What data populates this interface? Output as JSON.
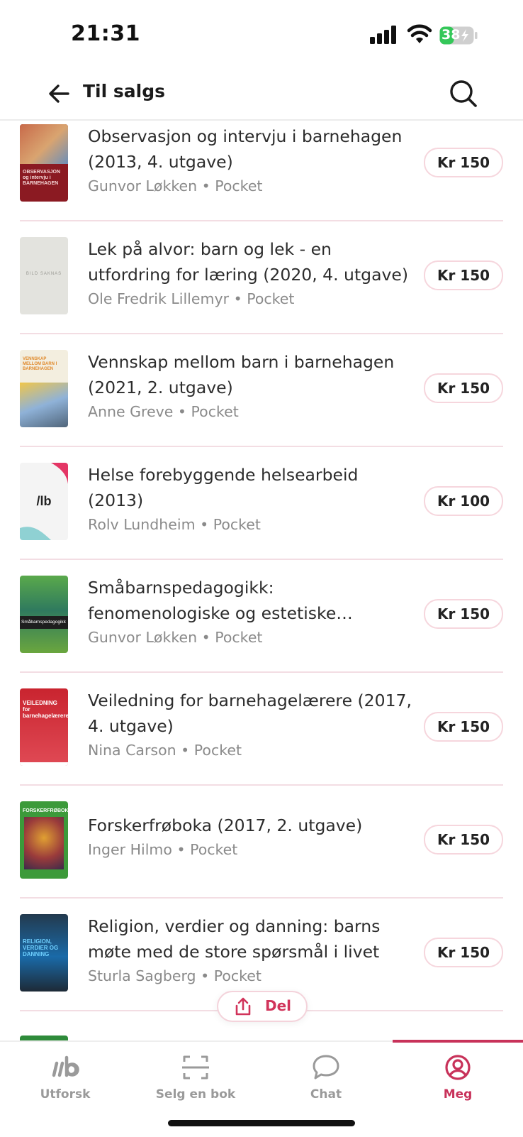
{
  "status_bar": {
    "time": "21:31",
    "battery": "38"
  },
  "header": {
    "title": "Til salgs"
  },
  "books": [
    {
      "title": "Observasjon og intervju i barnehagen (2013, 4. utgave)",
      "author": "Gunvor Løkken",
      "separator": "•",
      "format": "Pocket",
      "price": "Kr 150",
      "cover": {
        "bg": "#8b1a22",
        "label": "OBSERVASJON og intervju i BARNEHAGEN"
      }
    },
    {
      "title": "Lek på alvor: barn og lek - en utfordring for læring (2020, 4. utgave)",
      "author": "Ole Fredrik Lillemyr",
      "separator": "•",
      "format": "Pocket",
      "price": "Kr 150",
      "cover": {
        "bg": "#e3e3de",
        "label": "BILD SAKNAS"
      }
    },
    {
      "title": "Vennskap mellom barn i barnehagen (2021, 2. utgave)",
      "author": "Anne Greve",
      "separator": "•",
      "format": "Pocket",
      "price": "Kr 150",
      "cover": {
        "bg": "#f3eedf",
        "label": "VENNSKAP MELLOM BARN I BARNEHAGEN"
      }
    },
    {
      "title": "Helse forebyggende helsearbeid (2013)",
      "author": "Rolv Lundheim",
      "separator": "•",
      "format": "Pocket",
      "price": "Kr 100",
      "cover": {
        "bg": "#f4f4f4",
        "label": "/lb"
      }
    },
    {
      "title": "Småbarnspedagogikk: fenomenologiske og estetiske tilnærminger",
      "author": "Gunvor Løkken",
      "separator": "•",
      "format": "Pocket",
      "price": "Kr 150",
      "cover": {
        "bg": "#4f9a3e",
        "label": "Småbarnspedagogikk"
      }
    },
    {
      "title": "Veiledning for barnehagelærere (2017, 4. utgave)",
      "author": "Nina Carson",
      "separator": "•",
      "format": "Pocket",
      "price": "Kr 150",
      "cover": {
        "bg": "#d63a44",
        "label": "VEILEDNING for barnehagelærere"
      }
    },
    {
      "title": "Forskerfrøboka (2017, 2. utgave)",
      "author": "Inger Hilmo",
      "separator": "•",
      "format": "Pocket",
      "price": "Kr 150",
      "cover": {
        "bg": "#3c9a3a",
        "label": "FORSKERFRØBOKA"
      }
    },
    {
      "title": "Religion, verdier og danning: barns møte med de store spørsmål i livet",
      "author": "Sturla Sagberg",
      "separator": "•",
      "format": "Pocket",
      "price": "Kr 150",
      "cover": {
        "bg": "#1e4b6e",
        "label": "RELIGION, VERDIER OG DANNING"
      }
    }
  ],
  "share": {
    "label": "Del"
  },
  "tabs": [
    {
      "label": "Utforsk",
      "icon": "logo-icon"
    },
    {
      "label": "Selg en bok",
      "icon": "scan-icon"
    },
    {
      "label": "Chat",
      "icon": "chat-bubble-icon"
    },
    {
      "label": "Meg",
      "icon": "profile-icon",
      "active": true
    }
  ],
  "colors": {
    "accent": "#c8325a",
    "divider": "#f3dde3",
    "muted": "#8a8a8a",
    "battery": "#34c759"
  }
}
